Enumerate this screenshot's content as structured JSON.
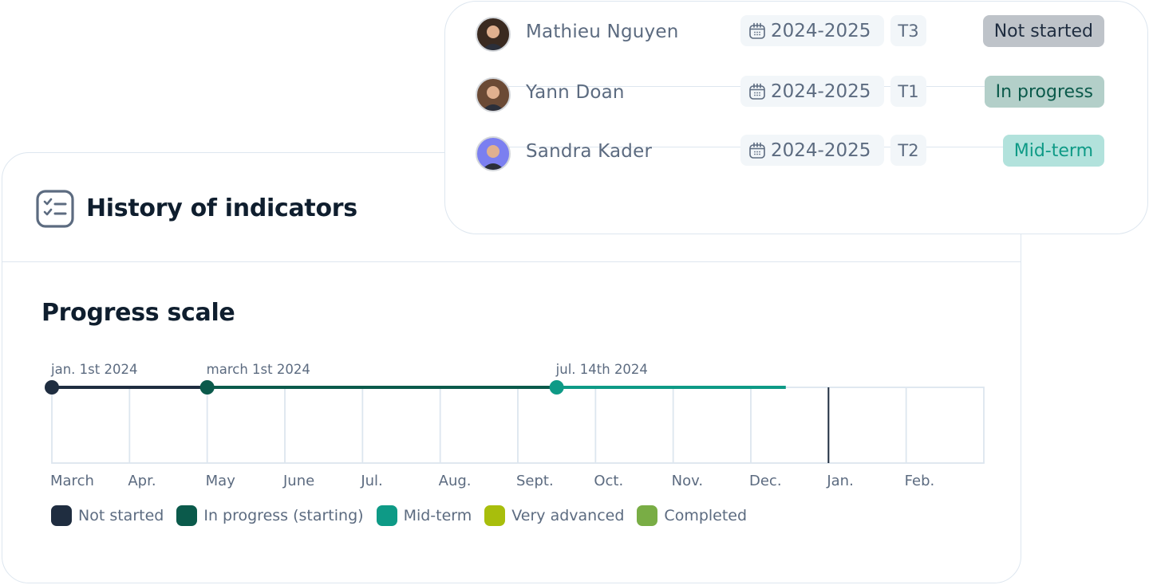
{
  "main_card": {
    "title": "History of indicators",
    "title_icon": "checklist-icon",
    "section_title": "Progress scale"
  },
  "chart_data": {
    "type": "timeline",
    "title": "Progress scale",
    "x_categories": [
      "March",
      "Apr.",
      "May",
      "June",
      "Jul.",
      "Aug.",
      "Sept.",
      "Oct.",
      "Nov.",
      "Dec.",
      "Jan.",
      "Feb."
    ],
    "current_marker_before": "Jan.",
    "milestones": [
      {
        "label": "jan. 1st 2024",
        "status": "Not started",
        "position_months": 0,
        "color": "#1f2d40"
      },
      {
        "label": "march 1st 2024",
        "status": "In progress (starting)",
        "position_months": 2,
        "color": "#0b5a4b"
      },
      {
        "label": "jul. 14th 2024",
        "status": "Mid-term",
        "position_months": 6.5,
        "color": "#0e9a86"
      }
    ],
    "segments": [
      {
        "from_months": 0,
        "to_months": 2,
        "status": "Not started",
        "color": "#1f2d40"
      },
      {
        "from_months": 2,
        "to_months": 6.5,
        "status": "In progress (starting)",
        "color": "#0b5a4b"
      },
      {
        "from_months": 6.5,
        "to_months": 9.45,
        "status": "Mid-term",
        "color": "#0e9a86"
      }
    ],
    "legend": [
      {
        "label": "Not started",
        "color": "#1f2d40"
      },
      {
        "label": "In progress (starting)",
        "color": "#0b5a4b"
      },
      {
        "label": "Mid-term",
        "color": "#0e9a86"
      },
      {
        "label": "Very advanced",
        "color": "#a8be0c"
      },
      {
        "label": "Completed",
        "color": "#79ad45"
      }
    ],
    "legend_position": "bottom-left",
    "grid": true
  },
  "people": [
    {
      "name": "Mathieu Nguyen",
      "year": "2024-2025",
      "term": "T3",
      "status": "Not started",
      "status_bg": "#bec3c9",
      "status_fg": "#1f2d40",
      "avatar": "avatar-mathieu",
      "avatar_bg": "#3a2a20"
    },
    {
      "name": "Yann Doan",
      "year": "2024-2025",
      "term": "T1",
      "status": "In progress",
      "status_bg": "#b3cfc9",
      "status_fg": "#0b5a4b",
      "avatar": "avatar-yann",
      "avatar_bg": "#6b4a35"
    },
    {
      "name": "Sandra Kader",
      "year": "2024-2025",
      "term": "T2",
      "status": "Mid-term",
      "status_bg": "#b2e2dc",
      "status_fg": "#0e9a86",
      "avatar": "avatar-sandra",
      "avatar_bg": "#7b7ff0"
    }
  ]
}
